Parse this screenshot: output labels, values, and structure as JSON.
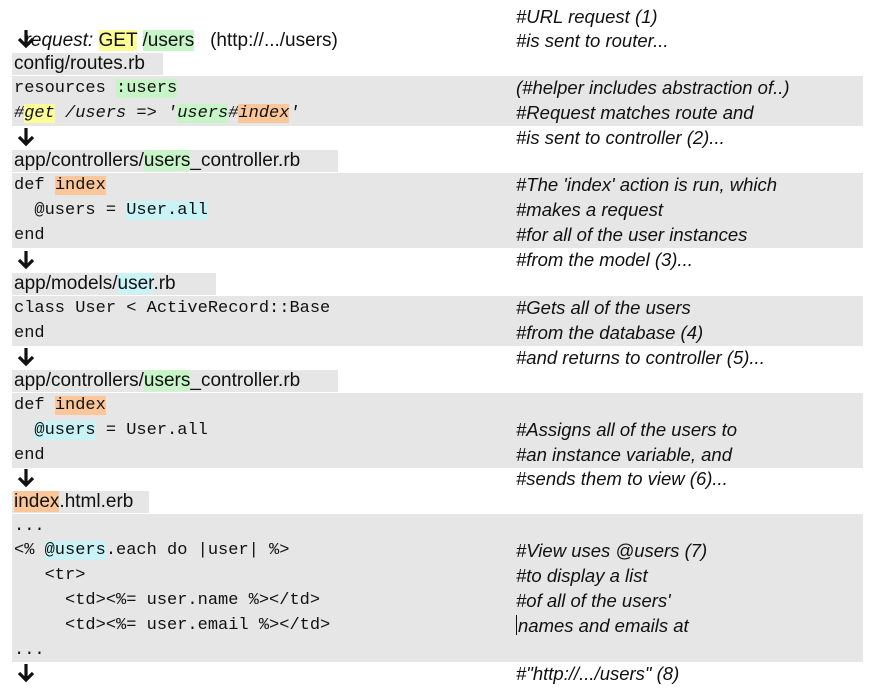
{
  "request": {
    "prefix": "request: ",
    "method": "GET",
    "space": " ",
    "path": "/users",
    "url": "   (http://.../users)"
  },
  "comments": [
    "#URL request (1)",
    "#is sent to router...",
    "(#helper includes abstraction of..)",
    "#Request matches route and",
    "#is sent to controller (2)...",
    "#The 'index' action is run, which",
    "#makes a request",
    "#for all of the user instances",
    "#from the model (3)...",
    "#Gets all of the users",
    "#from the database (4)",
    "#and returns to controller (5)...",
    "#Assigns all of the users to",
    "#an instance variable, and",
    "#sends them to view (6)...",
    "#View uses @users (7)",
    "#to display a list",
    "#of all of the users'",
    "names and emails at",
    "#\"http://.../users\" (8)"
  ],
  "routes": {
    "file": "config/routes.rb",
    "line1": {
      "a": "resources ",
      "b": ":users"
    },
    "line2": {
      "a": "#",
      "b": "get",
      "c": " /users => '",
      "d": "users",
      "e": "#",
      "f": "index",
      "g": "'"
    }
  },
  "controller1": {
    "file": {
      "a": "app/controllers/",
      "b": "users",
      "c": "_controller.rb"
    },
    "def": {
      "a": "def ",
      "b": "index"
    },
    "assign": {
      "a": "  @users = ",
      "b": "User.all"
    },
    "end": "end"
  },
  "model": {
    "file": {
      "a": "app/models/",
      "b": "user",
      "c": ".rb"
    },
    "class_line": "class User < ActiveRecord::Base",
    "end": "end"
  },
  "controller2": {
    "file": {
      "a": "app/controllers/",
      "b": "users",
      "c": "_controller.rb"
    },
    "def": {
      "a": "def ",
      "b": "index"
    },
    "assign": {
      "a": "  ",
      "b": "@users",
      "c": " = User.all"
    },
    "end": "end"
  },
  "view": {
    "file": {
      "a": "index",
      "b": ".html.erb"
    },
    "dots_top": "...",
    "each": {
      "a": "<% ",
      "b": "@users",
      "c": ".each do |user| %>"
    },
    "tr": "   <tr>",
    "td_name": "     <td><%= user.name %></td>",
    "td_email": "     <td><%= user.email %></td>",
    "dots_bottom": "..."
  },
  "colors": {
    "band": "#e6e6e6",
    "yellow": "#fdfd96",
    "green": "#c8f5c8",
    "orange": "#fbc79a",
    "cyan": "#c9f3f6"
  },
  "icons": [
    "down-arrow-icon"
  ]
}
